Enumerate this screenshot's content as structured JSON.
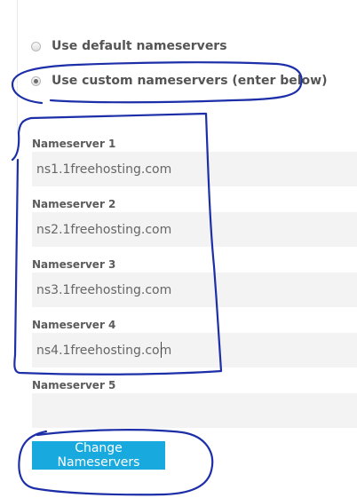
{
  "nameserver_options": {
    "default_label": "Use default nameservers",
    "custom_label": "Use custom nameservers (enter below)",
    "selected": "custom"
  },
  "nameservers": [
    {
      "label": "Nameserver 1",
      "value": "ns1.1freehosting.com"
    },
    {
      "label": "Nameserver 2",
      "value": "ns2.1freehosting.com"
    },
    {
      "label": "Nameserver 3",
      "value": "ns3.1freehosting.com"
    },
    {
      "label": "Nameserver 4",
      "value": "ns4.1freehosting.com"
    },
    {
      "label": "Nameserver 5",
      "value": ""
    }
  ],
  "submit_label": "Change Nameservers",
  "colors": {
    "button": "#18a9df",
    "annotation": "#1d2fa8",
    "input_background": "#f3f3f3"
  }
}
